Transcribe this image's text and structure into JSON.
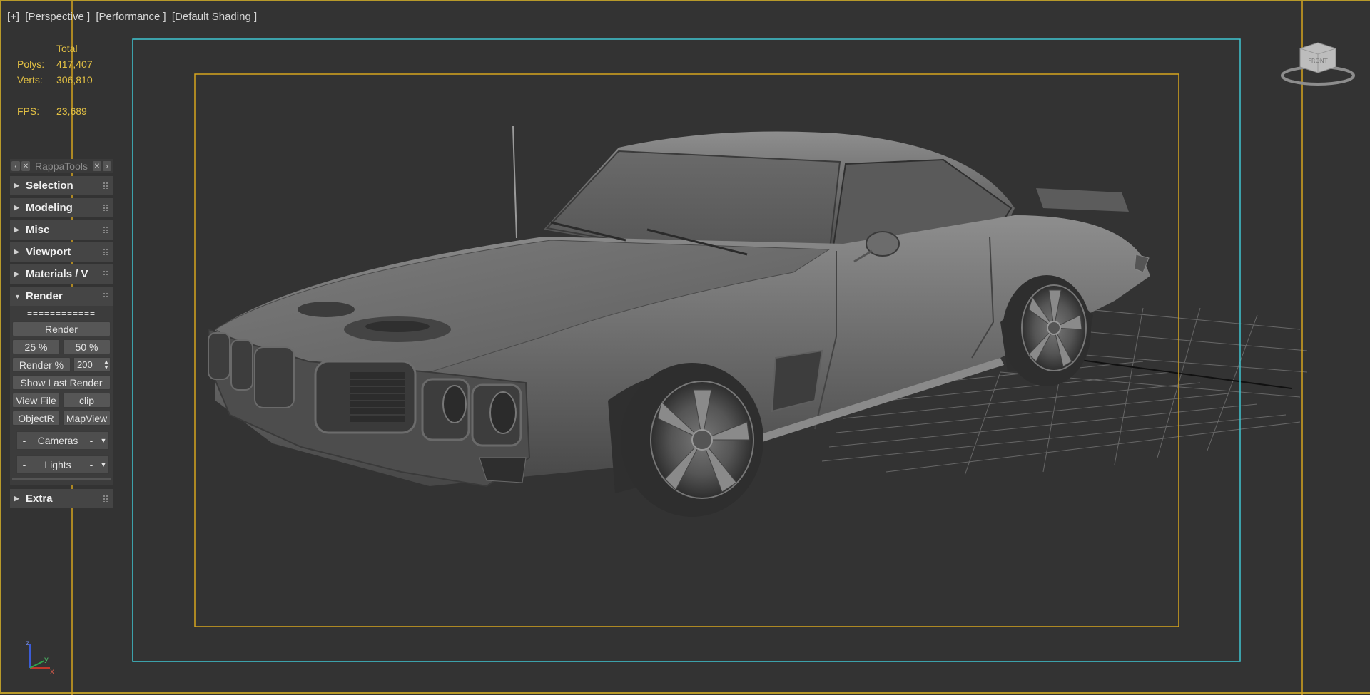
{
  "viewport": {
    "labels": [
      "[+]",
      "[Perspective ]",
      "[Performance ]",
      "[Default Shading ]"
    ]
  },
  "stats": {
    "total_header": "Total",
    "polys_label": "Polys:",
    "polys_value": "417,407",
    "verts_label": "Verts:",
    "verts_value": "306,810",
    "fps_label": "FPS:",
    "fps_value": "23,689"
  },
  "rappatools": {
    "title": "RappaTools",
    "rollouts": [
      {
        "label": "Selection",
        "expanded": false
      },
      {
        "label": "Modeling",
        "expanded": false
      },
      {
        "label": "Misc",
        "expanded": false
      },
      {
        "label": "Viewport",
        "expanded": false
      },
      {
        "label": "Materials / V",
        "expanded": false
      },
      {
        "label": "Render",
        "expanded": true
      }
    ],
    "render": {
      "separator": "============",
      "render_button": "Render",
      "pct25": "25 %",
      "pct50": "50 %",
      "render_pct_button": "Render %",
      "render_pct_value": "200",
      "show_last_render": "Show Last Render",
      "view_file": "View File",
      "clip": "clip",
      "objectr": "ObjectR",
      "mapview": "MapView",
      "cameras_label": "Cameras",
      "lights_label": "Lights",
      "dash": "-"
    },
    "extra_rollout": "Extra"
  },
  "viewcube": {
    "face_label": "FRONT"
  },
  "axis": {
    "x": "x",
    "y": "y",
    "z": "z"
  },
  "colors": {
    "safe_frame_outer": "#3fc6d2",
    "safe_frame_inner": "#d6a51e",
    "viewport_border": "#b89a2a",
    "stats_text": "#e3c144"
  }
}
